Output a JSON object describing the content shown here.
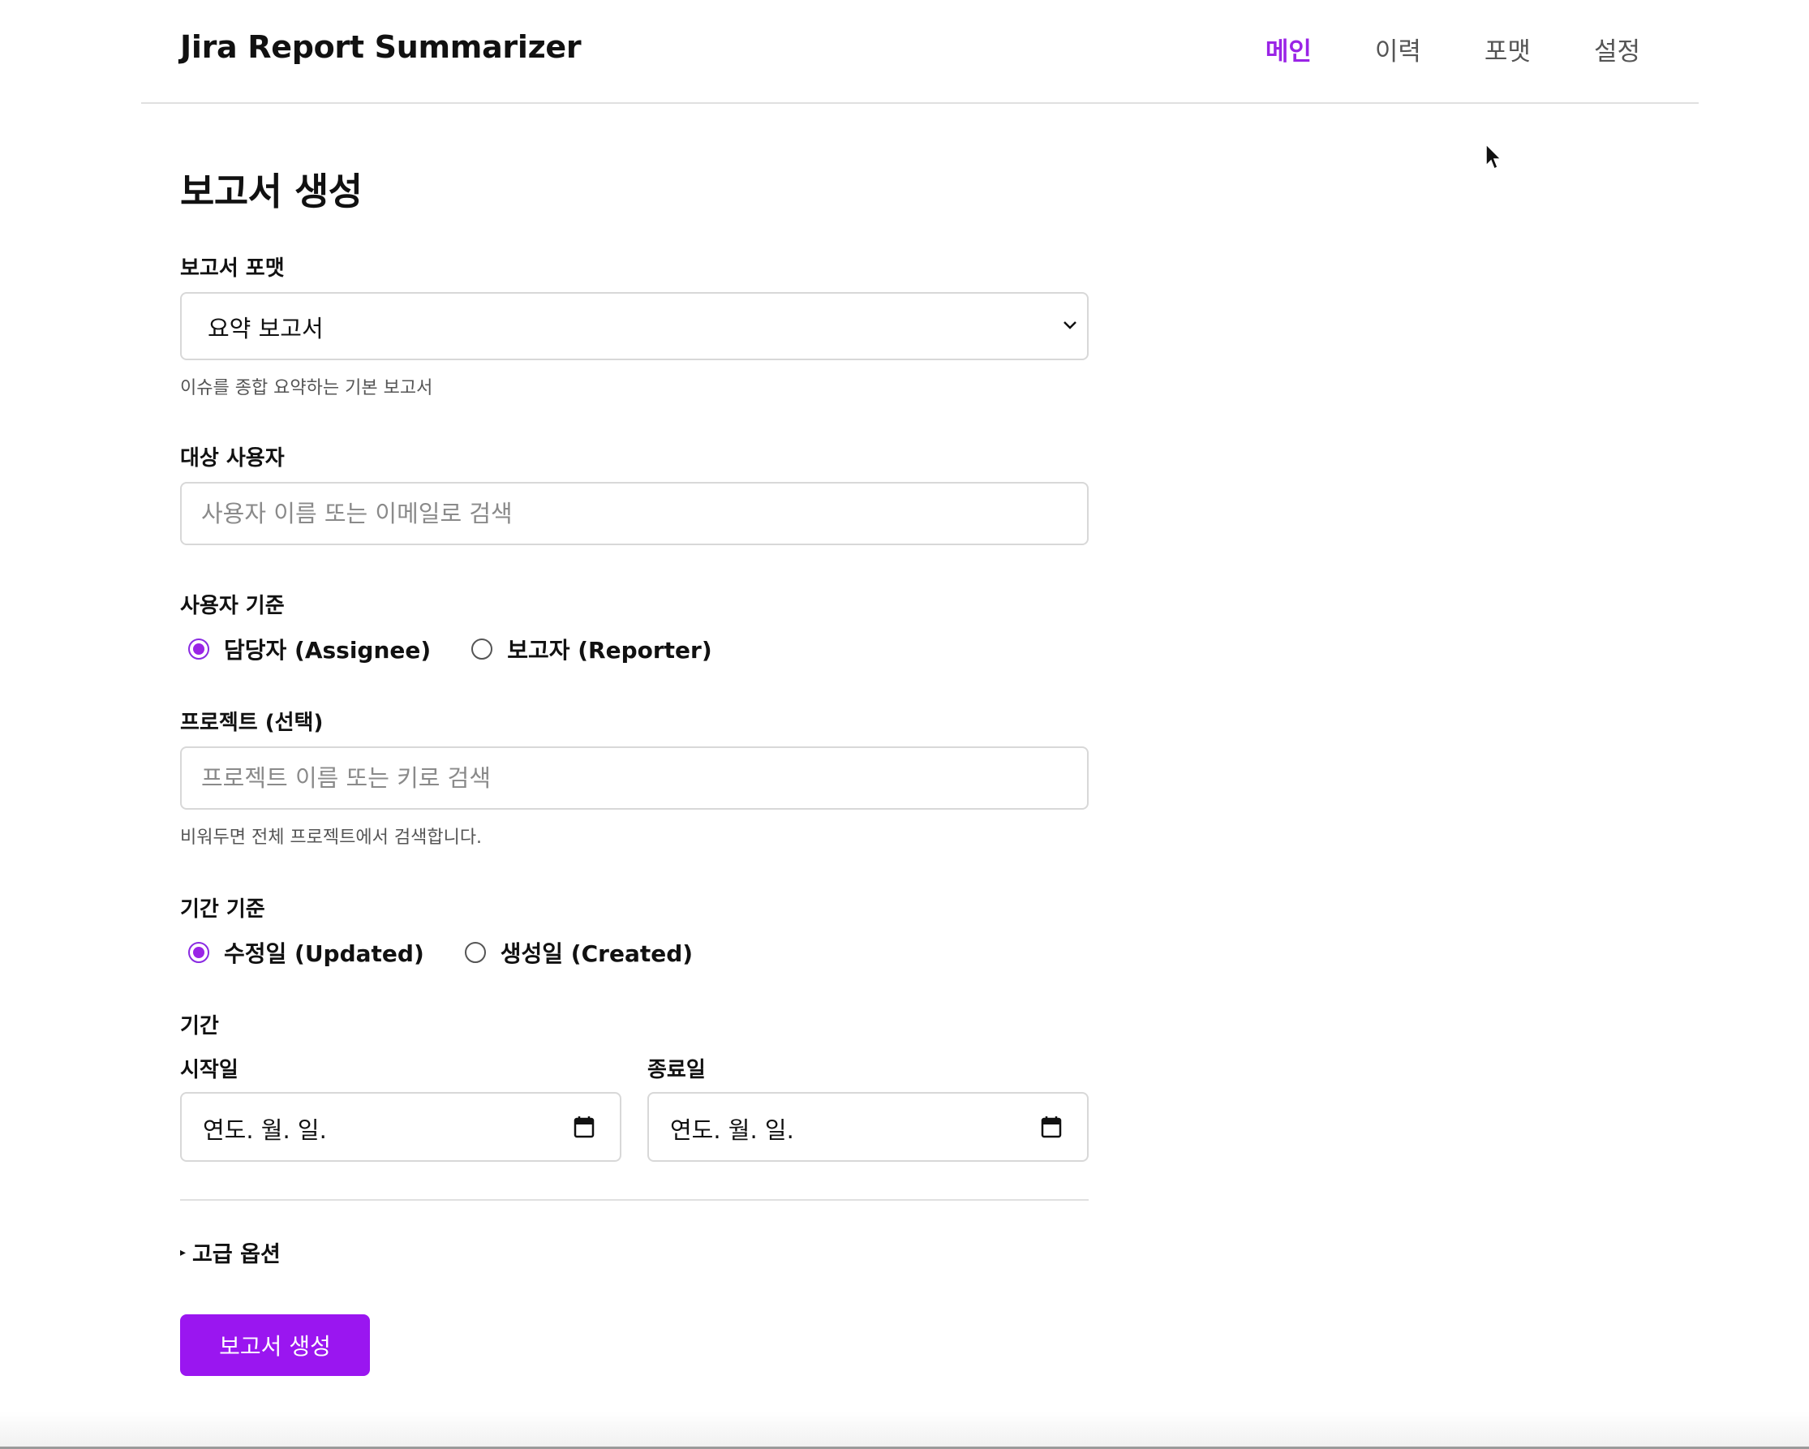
{
  "header": {
    "app_title": "Jira Report Summarizer",
    "nav": [
      {
        "label": "메인",
        "active": true
      },
      {
        "label": "이력",
        "active": false
      },
      {
        "label": "포맷",
        "active": false
      },
      {
        "label": "설정",
        "active": false
      }
    ]
  },
  "page_title": "보고서 생성",
  "report_format": {
    "label": "보고서 포맷",
    "selected": "요약 보고서",
    "hint": "이슈를 종합 요약하는 기본 보고서"
  },
  "target_user": {
    "label": "대상 사용자",
    "placeholder": "사용자 이름 또는 이메일로 검색"
  },
  "user_basis": {
    "label": "사용자 기준",
    "options": [
      {
        "label": "담당자 (Assignee)",
        "checked": true
      },
      {
        "label": "보고자 (Reporter)",
        "checked": false
      }
    ]
  },
  "project": {
    "label": "프로젝트 (선택)",
    "placeholder": "프로젝트 이름 또는 키로 검색",
    "hint": "비워두면 전체 프로젝트에서 검색합니다."
  },
  "period_basis": {
    "label": "기간 기준",
    "options": [
      {
        "label": "수정일 (Updated)",
        "checked": true
      },
      {
        "label": "생성일 (Created)",
        "checked": false
      }
    ]
  },
  "period": {
    "label": "기간",
    "start_label": "시작일",
    "start_value": "연도. 월. 일.",
    "end_label": "종료일",
    "end_value": "연도. 월. 일."
  },
  "advanced": {
    "label": "고급 옵션"
  },
  "submit_label": "보고서 생성",
  "colors": {
    "accent": "#9a16f0",
    "nav_active": "#9a24e6"
  }
}
